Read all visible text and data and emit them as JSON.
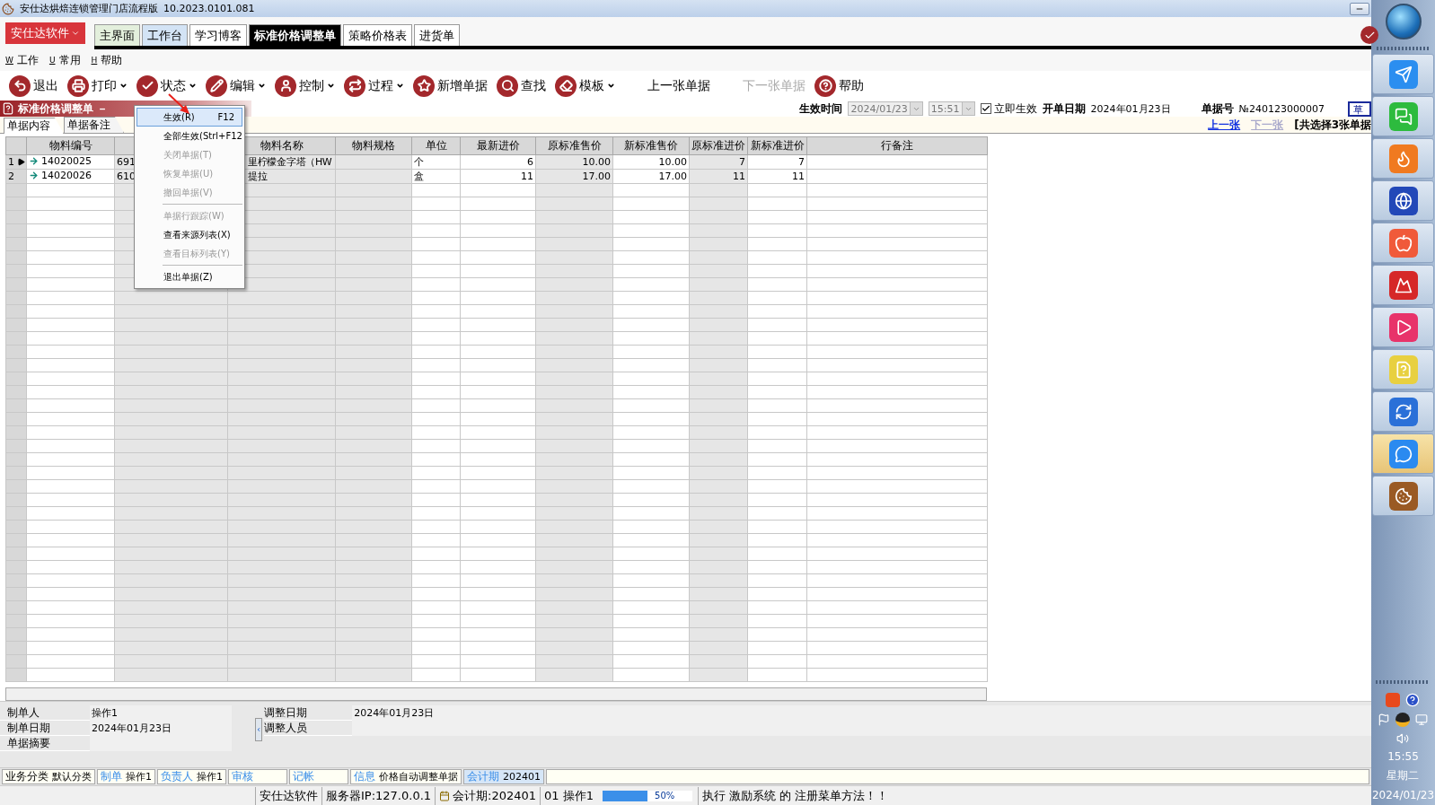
{
  "window": {
    "title": "安仕达烘焙连锁管理门店流程版",
    "version": "10.2023.0101.081"
  },
  "brand_menu": {
    "label": "安仕达软件"
  },
  "tabs": [
    {
      "label": "主界面",
      "selected": false,
      "color": "#e3efdc"
    },
    {
      "label": "工作台",
      "selected": false,
      "color": "#d3e3f5"
    },
    {
      "label": "学习博客",
      "selected": false,
      "color": "#ffffff"
    },
    {
      "label": "标准价格调整单",
      "selected": true,
      "color": "#000000"
    },
    {
      "label": "策略价格表",
      "selected": false,
      "color": "#ffffff"
    },
    {
      "label": "进货单",
      "selected": false,
      "color": "#ffffff"
    }
  ],
  "menu_bar": [
    {
      "key": "W",
      "label": "工作"
    },
    {
      "key": "U",
      "label": "常用"
    },
    {
      "key": "H",
      "label": "帮助"
    }
  ],
  "toolbar": [
    {
      "label": "退出",
      "dropdown": false,
      "disabled": false
    },
    {
      "label": "打印",
      "dropdown": true,
      "disabled": false
    },
    {
      "label": "状态",
      "dropdown": true,
      "disabled": false
    },
    {
      "label": "编辑",
      "dropdown": true,
      "disabled": false
    },
    {
      "label": "控制",
      "dropdown": true,
      "disabled": false
    },
    {
      "label": "过程",
      "dropdown": true,
      "disabled": false
    },
    {
      "label": "新增单据",
      "dropdown": false,
      "disabled": false
    },
    {
      "label": "查找",
      "dropdown": false,
      "disabled": false
    },
    {
      "label": "模板",
      "dropdown": true,
      "disabled": false
    },
    {
      "label": "上一张单据",
      "dropdown": false,
      "disabled": false
    },
    {
      "label": "下一张单据",
      "dropdown": false,
      "disabled": true
    },
    {
      "label": "帮助",
      "dropdown": false,
      "disabled": false
    }
  ],
  "document": {
    "title": "标准价格调整单 －",
    "effective_time": {
      "label": "生效时间",
      "date": "2024/01/23",
      "time": "15:51"
    },
    "immediate": {
      "label": "立即生效",
      "checked": true
    },
    "open_date": {
      "label": "开单日期",
      "value": "2024年01月23日"
    },
    "number": {
      "label": "单据号",
      "value": "№240123000007"
    },
    "edge_button": "草"
  },
  "sub_tabs": [
    {
      "label": "单据内容",
      "selected": true
    },
    {
      "label": "单据备注",
      "selected": false
    }
  ],
  "nav_links": [
    {
      "label": "上一张",
      "disabled": false
    },
    {
      "label": "下一张",
      "disabled": true
    }
  ],
  "selection_note": "[共选择3张单据",
  "grid": {
    "columns": [
      {
        "title": "物料编号",
        "readonly": false,
        "numeric": false
      },
      {
        "readonly": true,
        "numeric": false
      },
      {
        "title": "物料名称",
        "readonly": true,
        "numeric": false
      },
      {
        "title": "物料规格",
        "readonly": true
      },
      {
        "title": "单位",
        "readonly": false,
        "numeric": false
      },
      {
        "title": "最新进价",
        "readonly": false,
        "numeric": true
      },
      {
        "title": "原标准售价",
        "readonly": true,
        "numeric": true
      },
      {
        "title": "新标准售价",
        "readonly": false,
        "numeric": true
      },
      {
        "title": "原标准进价",
        "readonly": true,
        "numeric": true
      },
      {
        "title": "新标准进价",
        "readonly": false,
        "numeric": true
      },
      {
        "title": "行备注",
        "readonly": false
      }
    ],
    "rows": [
      {
        "number": "1",
        "current": true,
        "cells": [
          "14020025",
          "691",
          "里柠檬金字塔（HW",
          "",
          "个",
          "6",
          "10.00",
          "10.00",
          "7",
          "7",
          ""
        ]
      },
      {
        "number": "2",
        "current": false,
        "cells": [
          "14020026",
          "610",
          "提拉",
          "",
          "盒",
          "11",
          "17.00",
          "17.00",
          "11",
          "11",
          ""
        ]
      }
    ]
  },
  "context_menu": [
    {
      "kind": "item",
      "label": "生效(R)",
      "shortcut": "F12",
      "selected": true,
      "disabled": false
    },
    {
      "kind": "item",
      "label": "全部生效(S",
      "shortcut": "trl+F12",
      "selected": false,
      "disabled": false
    },
    {
      "kind": "item",
      "label": "关闭单据(T)",
      "selected": false,
      "disabled": true
    },
    {
      "kind": "item",
      "label": "恢复单据(U)",
      "selected": false,
      "disabled": true
    },
    {
      "kind": "item",
      "label": "撤回单据(V)",
      "selected": false,
      "disabled": true
    },
    {
      "kind": "separator"
    },
    {
      "kind": "item",
      "label": "单据行跟踪(W)",
      "selected": false,
      "disabled": true
    },
    {
      "kind": "item",
      "label": "查看来源列表(X)",
      "selected": false,
      "disabled": false
    },
    {
      "kind": "item",
      "label": "查看目标列表(Y)",
      "selected": false,
      "disabled": true
    },
    {
      "kind": "separator"
    },
    {
      "kind": "item",
      "label": "退出单据(Z)",
      "selected": false,
      "disabled": false
    }
  ],
  "info_left": [
    {
      "label": "制单人",
      "value": "操作1"
    },
    {
      "label": "制单日期",
      "value": "2024年01月23日"
    },
    {
      "label": "单据摘要"
    }
  ],
  "info_right": [
    {
      "label": "调整日期",
      "value": "2024年01月23日"
    },
    {
      "label": "调整人员"
    }
  ],
  "status_fields": [
    {
      "kind": "plain",
      "label": "业务分类",
      "value": "默认分类"
    },
    {
      "kind": "tagged",
      "label": "制单",
      "value": "操作1"
    },
    {
      "kind": "tagged",
      "label": "负责人",
      "value": "操作1"
    },
    {
      "kind": "tagged",
      "label": "审核"
    },
    {
      "kind": "tagged",
      "label": "记帐"
    },
    {
      "kind": "tagged",
      "label": "信息",
      "value": "价格自动调整单据"
    },
    {
      "kind": "accent",
      "label": "会计期",
      "value": "202401"
    }
  ],
  "status_bar": {
    "company": "安仕达软件",
    "server": "服务器IP:127.0.0.1",
    "period": "会计期:202401",
    "user": "01 操作1",
    "progress": {
      "level": 0.5,
      "reading": "50%"
    },
    "message": "执行 激励系统 的 注册菜单方法！！"
  },
  "taskbar": {
    "apps": [
      {
        "selected": false
      },
      {
        "selected": false
      },
      {
        "selected": false
      },
      {
        "selected": false
      },
      {
        "selected": false
      },
      {
        "selected": false
      },
      {
        "selected": false
      },
      {
        "selected": false
      },
      {
        "selected": false
      },
      {
        "selected": true
      },
      {
        "selected": false
      }
    ],
    "clock": {
      "time": "15:55",
      "weekday": "星期二",
      "date": "2024/01/23"
    }
  }
}
